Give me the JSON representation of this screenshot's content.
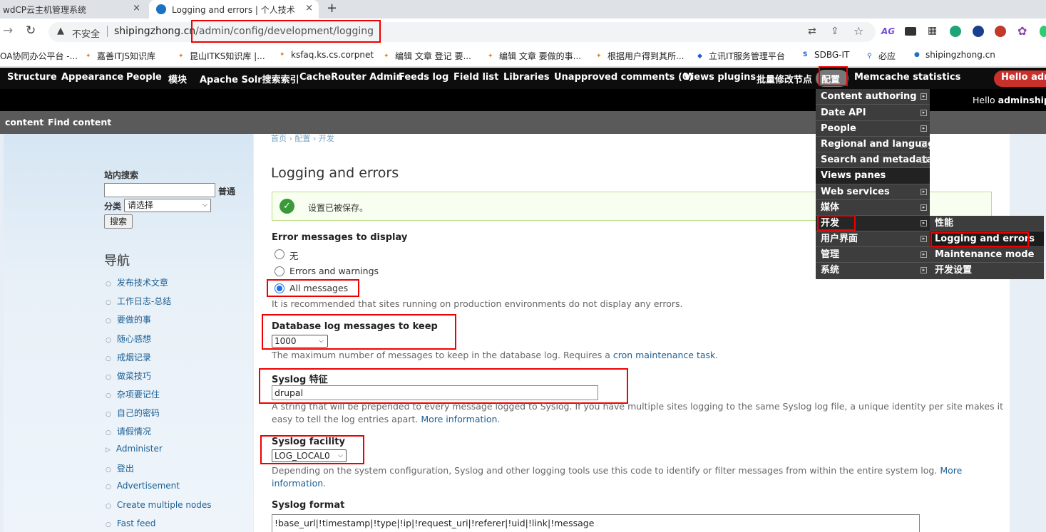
{
  "tabs": [
    {
      "title": "wdCP云主机管理系统",
      "close": "×"
    },
    {
      "title": "Logging and errors | 个人技术",
      "close": "×"
    }
  ],
  "new_tab": "+",
  "address": {
    "insecure": "不安全",
    "domain": "shipingzhong.cn",
    "path": "/admin/config/development/logging"
  },
  "ext_label": "AG",
  "bookmarks": [
    "OA协同办公平台 -...",
    "嘉善ITJS知识库",
    "昆山ITKS知识库 |...",
    "ksfaq.ks.cs.corpnet",
    "编辑 文章 登记 要...",
    "编辑 文章 要做的事...",
    "根据用户得到其所...",
    "立讯IT服务管理平台",
    "SDBG-IT",
    "必应",
    "shipingzhong.cn"
  ],
  "admin_menu": [
    "Structure",
    "Appearance",
    "People",
    "模块",
    "Apache Solr搜索索引",
    "CacheRouter Admin",
    "Feeds log",
    "Field list",
    "Libraries",
    "Unapproved comments (0)",
    "Views plugins",
    "批量修改节点",
    "配置",
    "Memcache statistics"
  ],
  "hello_badge": "Hello adm",
  "hello_user": {
    "prefix": "Hello ",
    "name": "adminship"
  },
  "shortcuts": [
    "content",
    "Find content"
  ],
  "breadcrumb": "首页 › 配置 › 开发",
  "sidebar": {
    "search_title": "站内搜索",
    "search_button_inline": "普通",
    "category_label": "分类",
    "category_value": "请选择",
    "search_button": "搜索",
    "nav_title": "导航",
    "nav_items": [
      "发布技术文章",
      "工作日志-总结",
      "要做的事",
      "随心感想",
      "戒烟记录",
      "做菜技巧",
      "杂项要记住",
      "自己的密码",
      "请假情况",
      "Administer",
      "登出",
      "Advertisement",
      "Create multiple nodes",
      "Fast feed"
    ]
  },
  "main": {
    "title": "Logging and errors",
    "status_message": "设置已被保存。",
    "error_messages": {
      "label": "Error messages to display",
      "options": [
        "无",
        "Errors and warnings",
        "All messages"
      ],
      "selected": "All messages",
      "description": "It is recommended that sites running on production environments do not display any errors."
    },
    "dblog": {
      "label": "Database log messages to keep",
      "value": "1000",
      "description": "The maximum number of messages to keep in the database log. Requires a ",
      "link": "cron maintenance task",
      "end": "."
    },
    "syslog_identity": {
      "label": "Syslog 特征",
      "value": "drupal",
      "description_line1": "A string that will be prepended to every message logged to Syslog. If you have multiple sites logging to the same Syslog log file, a unique identity per site makes it",
      "description_line2": "easy to tell the log entries apart. ",
      "link": "More information",
      "end": "."
    },
    "syslog_facility": {
      "label": "Syslog facility",
      "value": "LOG_LOCAL0",
      "description_line1": "Depending on the system configuration, Syslog and other logging tools use this code to identify or filter messages from within the entire system log. ",
      "link_line1": "More",
      "link_line2": "information",
      "end": "."
    },
    "syslog_format": {
      "label": "Syslog format",
      "value": "!base_url|!timestamp|!type|!ip|!request_uri|!referer|!uid|!link|!message"
    }
  },
  "config_dropdown": [
    "Content authoring",
    "Date API",
    "People",
    "Regional and language",
    "Search and metadata",
    "Views panes",
    "Web services",
    "媒体",
    "开发",
    "用户界面",
    "管理",
    "系统"
  ],
  "dev_submenu": [
    "性能",
    "Logging and errors",
    "Maintenance mode",
    "开发设置"
  ],
  "colors": {
    "admin_bar": "#0d0d0d",
    "menu_bg": "#3d3d3d",
    "link": "#1a5f94",
    "highlight": "#e00000",
    "hello_badge": "#c9302c"
  }
}
